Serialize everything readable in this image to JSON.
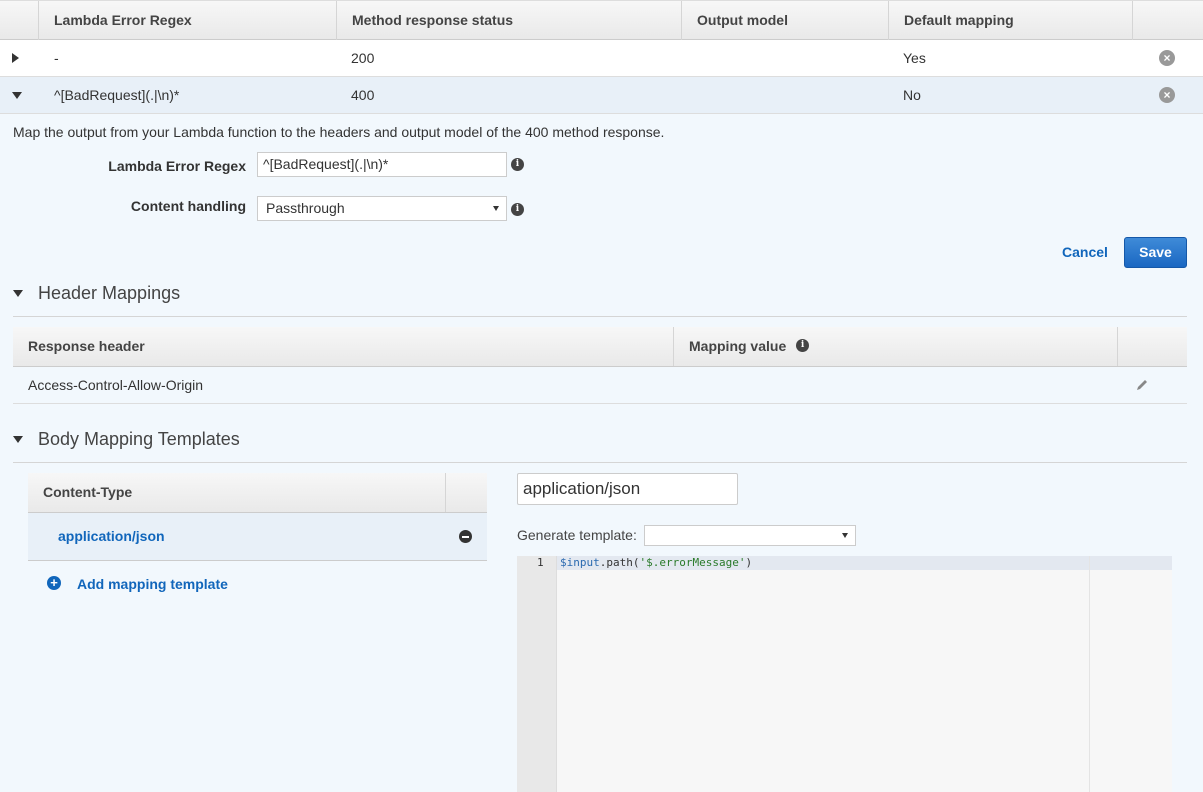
{
  "responses_table": {
    "columns": [
      "Lambda Error Regex",
      "Method response status",
      "Output model",
      "Default mapping"
    ],
    "rows": [
      {
        "regex": "-",
        "status": "200",
        "output_model": "",
        "default_mapping": "Yes",
        "expanded": false
      },
      {
        "regex": "^[BadRequest](.|\\n)*",
        "status": "400",
        "output_model": "",
        "default_mapping": "No",
        "expanded": true
      }
    ]
  },
  "detail": {
    "description": "Map the output from your Lambda function to the headers and output model of the 400 method response.",
    "regex_label": "Lambda Error Regex",
    "regex_value": "^[BadRequest](.|\\n)*",
    "content_handling_label": "Content handling",
    "content_handling_value": "Passthrough",
    "cancel_label": "Cancel",
    "save_label": "Save"
  },
  "header_mappings": {
    "title": "Header Mappings",
    "columns": [
      "Response header",
      "Mapping value"
    ],
    "rows": [
      {
        "header": "Access-Control-Allow-Origin",
        "value": ""
      }
    ]
  },
  "body_mapping": {
    "title": "Body Mapping Templates",
    "content_type_header": "Content-Type",
    "content_types": [
      "application/json"
    ],
    "add_label": "Add mapping template",
    "selected_content_type": "application/json",
    "generate_label": "Generate template:",
    "generate_value": "",
    "editor": {
      "line_number": "1",
      "code_var": "$input",
      "code_method": ".path(",
      "code_string": "'$.errorMessage'",
      "code_close": ")"
    }
  },
  "colors": {
    "accent": "#1166bb",
    "save_button": "#1a67c2",
    "selected_row": "#e8f0f8"
  }
}
